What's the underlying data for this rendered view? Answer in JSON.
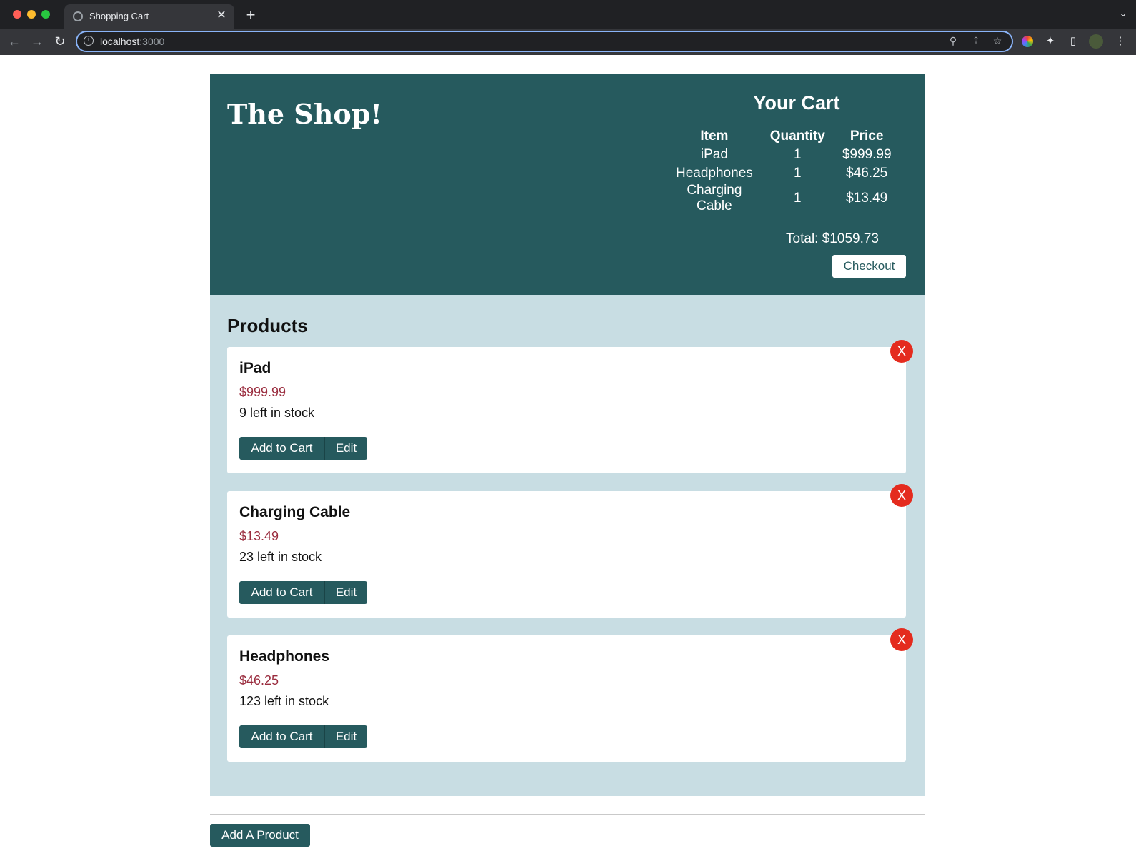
{
  "browser": {
    "tab_title": "Shopping Cart",
    "tab_close": "✕",
    "new_tab": "+",
    "url_host": "localhost",
    "url_port": ":3000",
    "icons": [
      "tab-favicon-icon",
      "back-icon",
      "forward-icon",
      "reload-icon",
      "info-icon",
      "zoom-icon",
      "share-icon",
      "star-icon",
      "color-extension-icon",
      "puzzle-icon",
      "side-panel-icon",
      "avatar",
      "kebab-menu-icon",
      "tab-list-chevron-icon"
    ]
  },
  "header": {
    "logo": "The Shop!",
    "cart": {
      "title": "Your Cart",
      "columns": [
        "Item",
        "Quantity",
        "Price"
      ],
      "items": [
        {
          "item": "iPad",
          "quantity": "1",
          "price": "$999.99"
        },
        {
          "item": "Headphones",
          "quantity": "1",
          "price": "$46.25"
        },
        {
          "item": "Charging Cable",
          "quantity": "1",
          "price": "$13.49"
        }
      ],
      "total": "Total: $1059.73",
      "checkout_label": "Checkout"
    }
  },
  "products": {
    "title": "Products",
    "add_to_cart_label": "Add to Cart",
    "edit_label": "Edit",
    "delete_label": "X",
    "items": [
      {
        "name": "iPad",
        "price": "$999.99",
        "stock": "9 left in stock"
      },
      {
        "name": "Charging Cable",
        "price": "$13.49",
        "stock": "23 left in stock"
      },
      {
        "name": "Headphones",
        "price": "$46.25",
        "stock": "123 left in stock"
      }
    ]
  },
  "footer": {
    "add_product_label": "Add A Product"
  },
  "colors": {
    "header_bg": "#265a5e",
    "products_bg": "#c8dde3",
    "price": "#9a2c3e",
    "delete": "#e42b1e"
  }
}
